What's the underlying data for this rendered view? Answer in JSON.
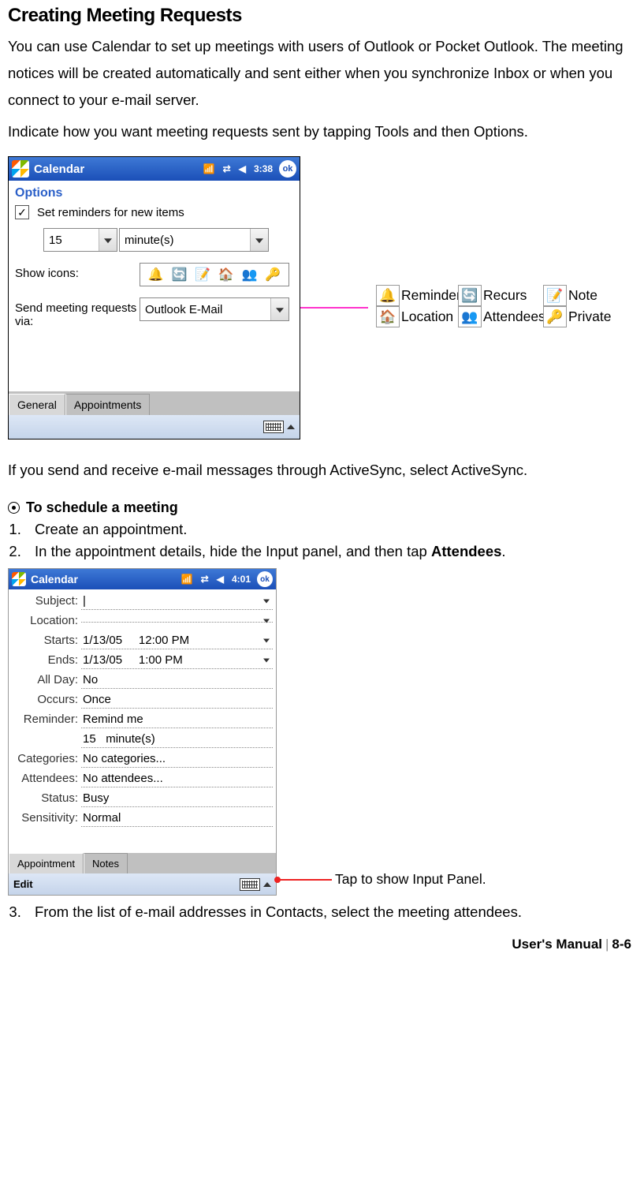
{
  "heading": "Creating Meeting Requests",
  "para1": "You can use Calendar to set up meetings with users of Outlook or Pocket Outlook. The meeting notices will be created automatically and sent either when you synchronize Inbox or when you connect to your e-mail server.",
  "para2": "Indicate how you want meeting requests sent by tapping Tools and then Options.",
  "shot1": {
    "title": "Calendar",
    "time": "3:38",
    "ok": "ok",
    "options": "Options",
    "reminders_label": "Set reminders for new items",
    "reminders_checked": true,
    "num": "15",
    "unit": "minute(s)",
    "show_icons": "Show icons:",
    "send_req": "Send meeting requests via:",
    "send_val": "Outlook E-Mail",
    "tab_general": "General",
    "tab_appts": "Appointments"
  },
  "legend": {
    "reminder": "Reminder",
    "recurs": "Recurs",
    "note": "Note",
    "location": "Location",
    "attendees": "Attendees",
    "private": "Private"
  },
  "para3": "If you send and receive e-mail messages through ActiveSync, select ActiveSync.",
  "schedule_heading": "To schedule a meeting",
  "step1": "Create an appointment.",
  "step2a": "In the appointment details, hide the Input panel, and then tap ",
  "step2b": "Attendees",
  "step2c": ".",
  "shot2": {
    "title": "Calendar",
    "time": "4:01",
    "ok": "ok",
    "fields": {
      "subject_l": "Subject:",
      "subject_v": "",
      "location_l": "Location:",
      "location_v": "",
      "starts_l": "Starts:",
      "starts_d": "1/13/05",
      "starts_t": "12:00 PM",
      "ends_l": "Ends:",
      "ends_d": "1/13/05",
      "ends_t": "1:00 PM",
      "allday_l": "All Day:",
      "allday_v": "No",
      "occurs_l": "Occurs:",
      "occurs_v": "Once",
      "reminder_l": "Reminder:",
      "reminder_v": "Remind me",
      "reminder_n": "15",
      "reminder_u": "minute(s)",
      "categories_l": "Categories:",
      "categories_v": "No categories...",
      "attendees_l": "Attendees:",
      "attendees_v": "No attendees...",
      "status_l": "Status:",
      "status_v": "Busy",
      "sensitivity_l": "Sensitivity:",
      "sensitivity_v": "Normal"
    },
    "tab_appt": "Appointment",
    "tab_notes": "Notes",
    "edit": "Edit"
  },
  "callout": "Tap to show Input Panel.",
  "step3": "From the list of e-mail addresses in Contacts, select the meeting attendees.",
  "footer_a": "User's Manual",
  "footer_b": "8-6"
}
